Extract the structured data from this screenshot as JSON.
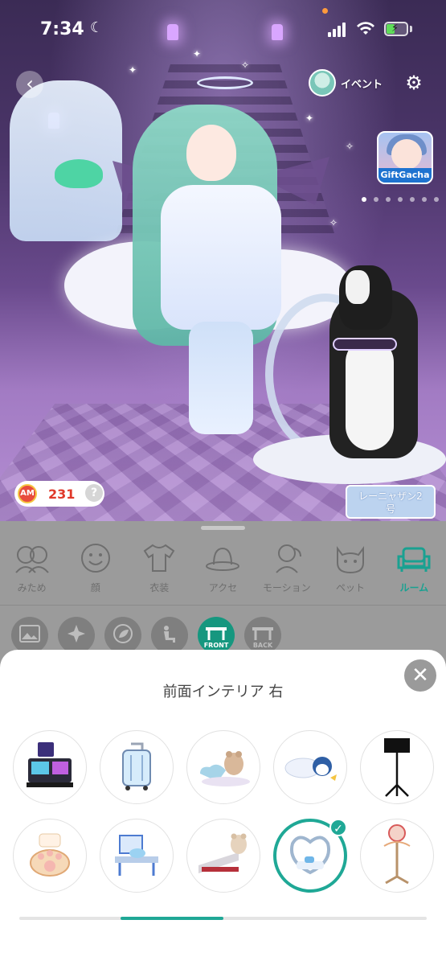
{
  "status_bar": {
    "time": "7:34",
    "moon": "☾"
  },
  "top": {
    "back_glyph": "‹",
    "event_label": "イベント",
    "gear_glyph": "⚙",
    "gift_card_label": "GiftGacha"
  },
  "currency": {
    "value": "231",
    "help": "?",
    "icon_text": "AM"
  },
  "pet_name_tag": {
    "line1": "レーニャザン2",
    "line2": "号"
  },
  "categories": [
    {
      "label": "みため",
      "icon": "faces-icon",
      "active": false
    },
    {
      "label": "顔",
      "icon": "smile-icon",
      "active": false
    },
    {
      "label": "衣装",
      "icon": "shirt-icon",
      "active": false
    },
    {
      "label": "アクセ",
      "icon": "hat-icon",
      "active": false
    },
    {
      "label": "モーション",
      "icon": "pose-icon",
      "active": false
    },
    {
      "label": "ペット",
      "icon": "cat-icon",
      "active": false
    },
    {
      "label": "ルーム",
      "icon": "sofa-icon",
      "active": true
    }
  ],
  "sub_tabs": [
    {
      "icon": "picture-icon",
      "tag": ""
    },
    {
      "icon": "sparkle-icon",
      "tag": ""
    },
    {
      "icon": "leaf-icon",
      "tag": ""
    },
    {
      "icon": "chair-icon",
      "tag": ""
    },
    {
      "icon": "table-front-icon",
      "tag": "FRONT"
    },
    {
      "icon": "table-back-icon",
      "tag": "BACK"
    }
  ],
  "sheet": {
    "title": "前面インテリア 右",
    "close_glyph": "✕",
    "selected_index": 8,
    "items": [
      {
        "icon": "game-console-icon"
      },
      {
        "icon": "suitcase-icon"
      },
      {
        "icon": "heart-cushion-teddy-icon"
      },
      {
        "icon": "penguin-pillow-icon"
      },
      {
        "icon": "music-stand-icon"
      },
      {
        "icon": "paw-chair-icon"
      },
      {
        "icon": "blue-desk-icon"
      },
      {
        "icon": "teddy-bench-icon"
      },
      {
        "icon": "heart-vanity-icon"
      },
      {
        "icon": "hat-stand-icon"
      }
    ]
  },
  "colors": {
    "accent": "#1fa896",
    "currency_red": "#e0392a",
    "gift_blue": "#1e73d0"
  }
}
